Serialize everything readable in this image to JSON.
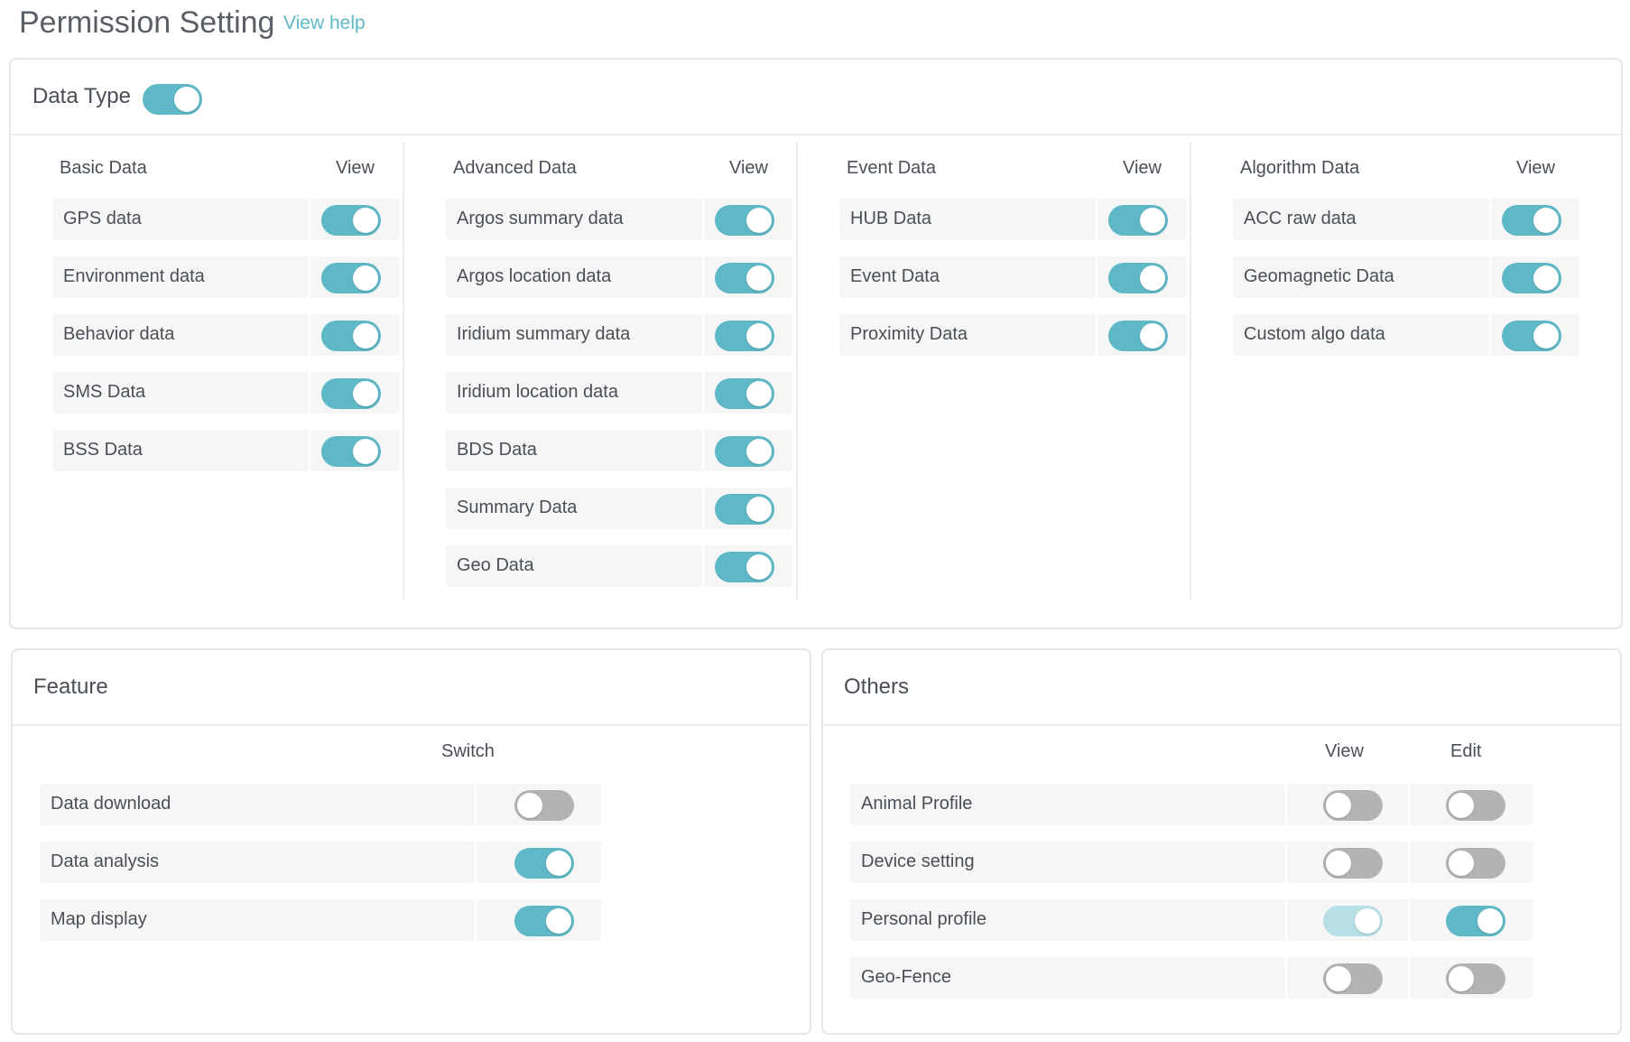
{
  "header": {
    "title": "Permission Setting",
    "help_link": "View help"
  },
  "colors": {
    "accent": "#5fb8c6",
    "accent_disabled": "#b6dfe6",
    "switch_off": "#b3b3b3"
  },
  "data_type": {
    "title": "Data Type",
    "master_switch": true,
    "columns": [
      {
        "name": "Basic Data",
        "view_label": "View",
        "items": [
          {
            "label": "GPS data",
            "view": true
          },
          {
            "label": "Environment data",
            "view": true
          },
          {
            "label": "Behavior data",
            "view": true
          },
          {
            "label": "SMS Data",
            "view": true
          },
          {
            "label": "BSS Data",
            "view": true
          }
        ]
      },
      {
        "name": "Advanced Data",
        "view_label": "View",
        "items": [
          {
            "label": "Argos summary data",
            "view": true
          },
          {
            "label": "Argos location data",
            "view": true
          },
          {
            "label": "Iridium summary data",
            "view": true
          },
          {
            "label": "Iridium location data",
            "view": true
          },
          {
            "label": "BDS Data",
            "view": true
          },
          {
            "label": "Summary Data",
            "view": true
          },
          {
            "label": "Geo Data",
            "view": true
          }
        ]
      },
      {
        "name": "Event Data",
        "view_label": "View",
        "items": [
          {
            "label": "HUB Data",
            "view": true
          },
          {
            "label": "Event Data",
            "view": true
          },
          {
            "label": "Proximity Data",
            "view": true
          }
        ]
      },
      {
        "name": "Algorithm Data",
        "view_label": "View",
        "items": [
          {
            "label": "ACC raw data",
            "view": true
          },
          {
            "label": "Geomagnetic Data",
            "view": true
          },
          {
            "label": "Custom algo data",
            "view": true
          }
        ]
      }
    ]
  },
  "feature": {
    "title": "Feature",
    "switch_label": "Switch",
    "items": [
      {
        "label": "Data download",
        "on": false
      },
      {
        "label": "Data analysis",
        "on": true
      },
      {
        "label": "Map display",
        "on": true
      }
    ]
  },
  "others": {
    "title": "Others",
    "view_label": "View",
    "edit_label": "Edit",
    "items": [
      {
        "label": "Animal Profile",
        "view": false,
        "edit": false
      },
      {
        "label": "Device setting",
        "view": false,
        "edit": false
      },
      {
        "label": "Personal profile",
        "view": true,
        "view_disabled": true,
        "edit": true
      },
      {
        "label": "Geo-Fence",
        "view": false,
        "edit": false
      }
    ]
  }
}
